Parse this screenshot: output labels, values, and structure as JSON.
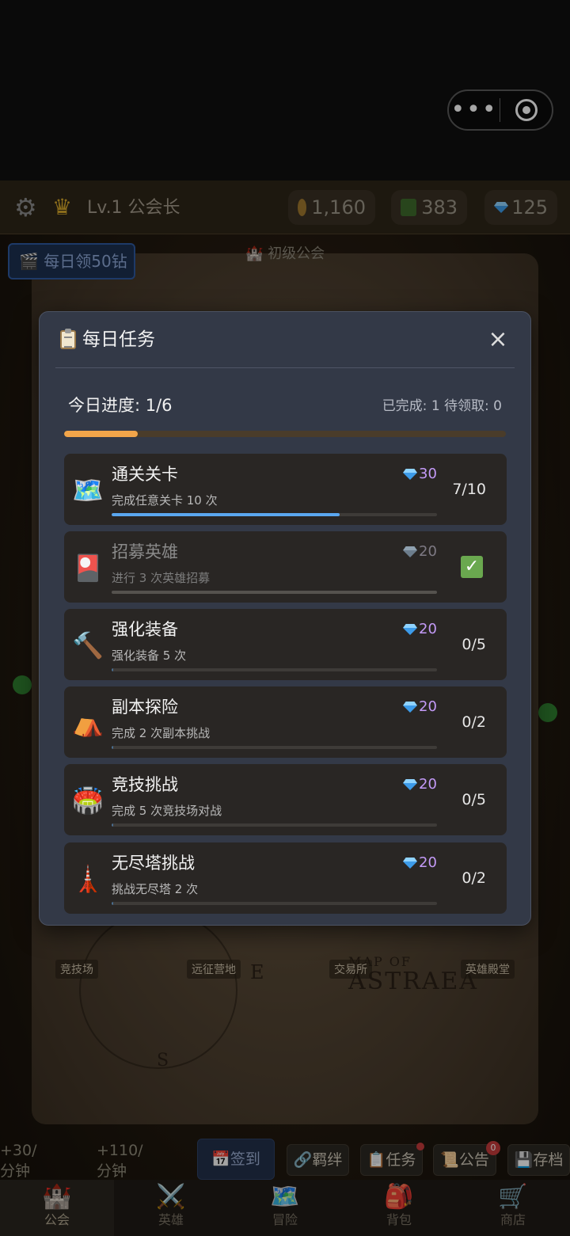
{
  "header": {
    "level_text": "Lv.1 公会长",
    "gold": "1,160",
    "wood": "383",
    "diamonds": "125"
  },
  "daily_button": "🎬 每日领50钻",
  "guild_label": "🏰 初级公会",
  "map": {
    "tags": [
      "竞技场",
      "远征营地",
      "交易所",
      "英雄殿堂"
    ],
    "title_small": "MAP OF",
    "title_big": "ASTRAEA",
    "compass_e": "E",
    "compass_s": "S"
  },
  "modal": {
    "title": "每日任务",
    "close": "×",
    "progress": "今日进度: 1/6",
    "stats": "已完成: 1   待领取: 0",
    "progress_fraction": 0.167,
    "tasks": [
      {
        "icon": "🗺️",
        "icon_name": "world-map-icon",
        "name": "通关关卡",
        "desc": "完成任意关卡 10 次",
        "reward": "30",
        "count": "7/10",
        "progress": 0.7,
        "done": false
      },
      {
        "icon": "🎴",
        "icon_name": "hero-card-icon",
        "name": "招募英雄",
        "desc": "进行 3 次英雄招募",
        "reward": "20",
        "count": "",
        "progress": 0,
        "done": true
      },
      {
        "icon": "🔨",
        "icon_name": "hammer-icon",
        "name": "强化装备",
        "desc": "强化装备 5 次",
        "reward": "20",
        "count": "0/5",
        "progress": 0,
        "done": false
      },
      {
        "icon": "⛺",
        "icon_name": "tent-icon",
        "name": "副本探险",
        "desc": "完成 2 次副本挑战",
        "reward": "20",
        "count": "0/2",
        "progress": 0,
        "done": false
      },
      {
        "icon": "🏟️",
        "icon_name": "stadium-icon",
        "name": "竞技挑战",
        "desc": "完成 5 次竞技场对战",
        "reward": "20",
        "count": "0/5",
        "progress": 0,
        "done": false
      },
      {
        "icon": "🗼",
        "icon_name": "tower-icon",
        "name": "无尽塔挑战",
        "desc": "挑战无尽塔 2 次",
        "reward": "20",
        "count": "0/2",
        "progress": 0,
        "done": false
      }
    ]
  },
  "income": {
    "gold": "+30/\n分钟",
    "wood": "+110/\n分钟"
  },
  "strip_buttons": {
    "sign": "📅签到",
    "bond": "🔗羁绊",
    "task": "📋任务",
    "notice": "📜公告",
    "notice_badge": "0",
    "save": "💾存档"
  },
  "nav": [
    {
      "label": "公会",
      "icon": "🏰"
    },
    {
      "label": "英雄",
      "icon": "⚔️"
    },
    {
      "label": "冒险",
      "icon": "🗺️"
    },
    {
      "label": "背包",
      "icon": "🎒"
    },
    {
      "label": "商店",
      "icon": "🛒"
    }
  ]
}
